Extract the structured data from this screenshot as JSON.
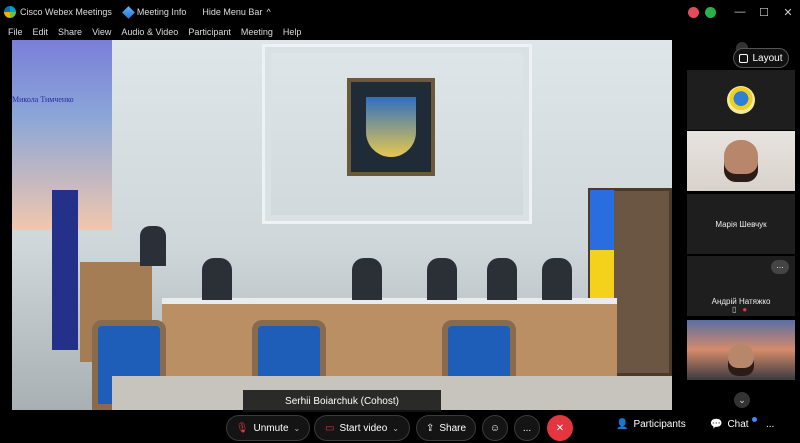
{
  "titlebar": {
    "app_name": "Cisco Webex Meetings",
    "meeting_info": "Meeting Info",
    "hide_menu": "Hide Menu Bar",
    "hide_menu_caret": "^",
    "minimize": "—",
    "maximize": "☐",
    "close": "✕"
  },
  "menu": [
    "File",
    "Edit",
    "Share",
    "View",
    "Audio & Video",
    "Participant",
    "Meeting",
    "Help"
  ],
  "stage": {
    "active_speaker": "Serhii Boiarchuk (Cohost)",
    "presentation_name": "Микола Тимченко"
  },
  "sidebar": {
    "layout_label": "Layout",
    "tiles": [
      {
        "name": "",
        "kind": "avatar"
      },
      {
        "name": "",
        "kind": "video"
      },
      {
        "name": "Марія Шевчук",
        "kind": "name"
      },
      {
        "name": "Андрій Натяжко",
        "kind": "name-more",
        "more": "..."
      },
      {
        "name": "",
        "kind": "video"
      }
    ],
    "scroll_down_icon": "chevron-down-icon"
  },
  "controls": {
    "unmute": "Unmute",
    "start_video": "Start video",
    "share": "Share",
    "more": "...",
    "participants": "Participants",
    "chat": "Chat",
    "overflow": "..."
  },
  "colors": {
    "end_button": "#e3363f",
    "mic_muted": "#e3363f",
    "chat_notification": "#3a8cff"
  }
}
